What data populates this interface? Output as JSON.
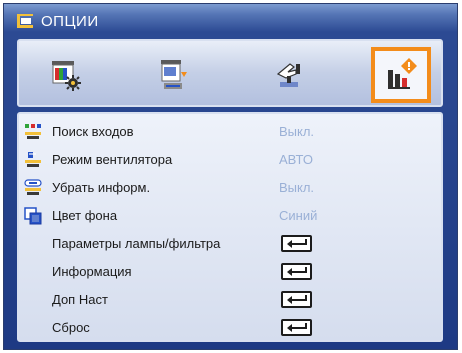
{
  "window": {
    "title": "ОПЦИИ"
  },
  "tabs": [
    {
      "name": "image-settings",
      "icon": "color-palette-screen-icon",
      "selected": false
    },
    {
      "name": "screen-settings",
      "icon": "screen-projection-icon",
      "selected": false
    },
    {
      "name": "setup",
      "icon": "hand-settings-icon",
      "selected": false
    },
    {
      "name": "options",
      "icon": "options-bars-icon",
      "selected": true
    }
  ],
  "menu": {
    "items": [
      {
        "label": "Поиск входов",
        "value": "Выкл.",
        "icon": "source-search-icon"
      },
      {
        "label": "Режим вентилятора",
        "value": "АВТО",
        "icon": "fan-mode-icon"
      },
      {
        "label": "Убрать информ.",
        "value": "Выкл.",
        "icon": "info-hide-icon"
      },
      {
        "label": "Цвет фона",
        "value": "Синий",
        "icon": "background-color-icon"
      },
      {
        "label": "Параметры лампы/фильтра",
        "value": "",
        "icon": "enter-key-icon"
      },
      {
        "label": "Информация",
        "value": "",
        "icon": "enter-key-icon"
      },
      {
        "label": "Доп Наст",
        "value": "",
        "icon": "enter-key-icon"
      },
      {
        "label": "Сброс",
        "value": "",
        "icon": "enter-key-icon"
      }
    ]
  },
  "colors": {
    "accent_selected": "#f38c1b",
    "value_text": "#9ab0d6",
    "frame_blue": "#1e3a84"
  }
}
